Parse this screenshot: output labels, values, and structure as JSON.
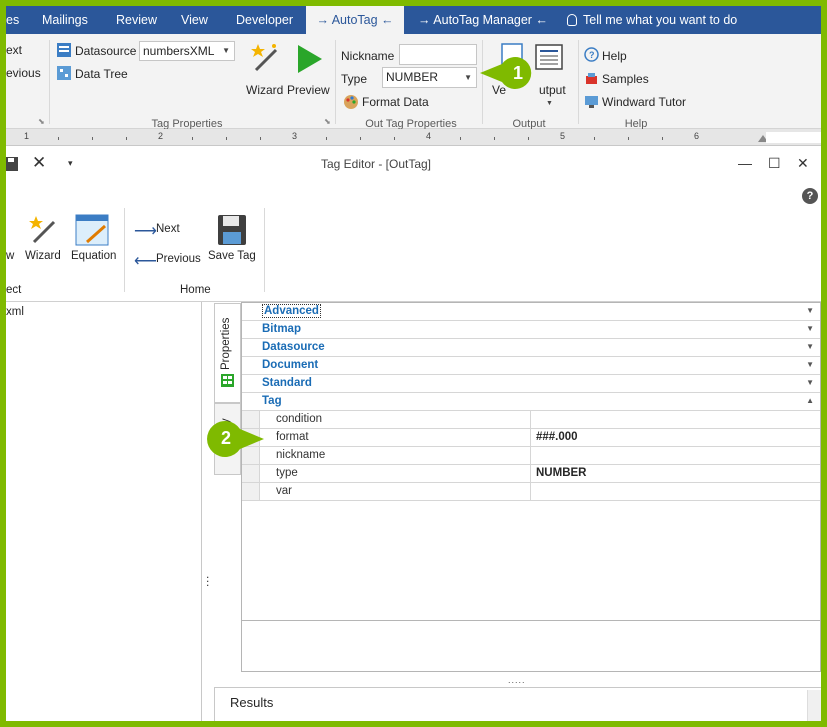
{
  "ribbon": {
    "tabs": [
      "es",
      "Mailings",
      "Review",
      "View",
      "Developer",
      "→ AutoTag ←",
      "→ AutoTag Manager ←",
      "Tell me what you want to do"
    ],
    "left_items": [
      "ext",
      "evious"
    ],
    "datasource_label": "Datasource",
    "datasource_value": "numbersXML",
    "data_tree_label": "Data Tree",
    "wizard_label": "Wizard",
    "preview_label": "Preview",
    "tag_properties_group": "Tag Properties",
    "nickname_label": "Nickname",
    "nickname_value": "",
    "type_label": "Type",
    "type_value": "NUMBER",
    "format_data_label": "Format Data",
    "out_tag_properties_group": "Out Tag Properties",
    "output_fragment_left": "Ve",
    "output_fragment_right": "utput",
    "output_group": "Output",
    "help_label": "Help",
    "samples_label": "Samples",
    "windward_tutor_label": "Windward Tutor",
    "help_group": "Help",
    "ruler_numbers": [
      "1",
      "2",
      "3",
      "4",
      "5",
      "6"
    ]
  },
  "editor": {
    "title": "Tag Editor - [OutTag]",
    "help_glyph": "?",
    "toolbar": {
      "left_fragment": "w",
      "wizard_label": "Wizard",
      "equation_label": "Equation",
      "next_label": "Next",
      "previous_label": "Previous",
      "save_tag_label": "Save Tag",
      "home_group": "Home",
      "left_group_fragment": "ect"
    },
    "tree_item_fragment": "xml",
    "vertical_tabs": [
      "Properties",
      "ry"
    ],
    "categories": [
      "Advanced",
      "Bitmap",
      "Datasource",
      "Document",
      "Standard",
      "Tag"
    ],
    "properties": [
      {
        "name": "condition",
        "value": ""
      },
      {
        "name": "format",
        "value": "###.000"
      },
      {
        "name": "nickname",
        "value": ""
      },
      {
        "name": "type",
        "value": "NUMBER"
      },
      {
        "name": "var",
        "value": ""
      }
    ],
    "splitter_dots": ".....",
    "results_label": "Results"
  },
  "callouts": [
    "1",
    "2"
  ],
  "colors": {
    "accent_green": "#7fba00",
    "ribbon_blue": "#2b579a",
    "category_blue": "#1a6cb5"
  }
}
